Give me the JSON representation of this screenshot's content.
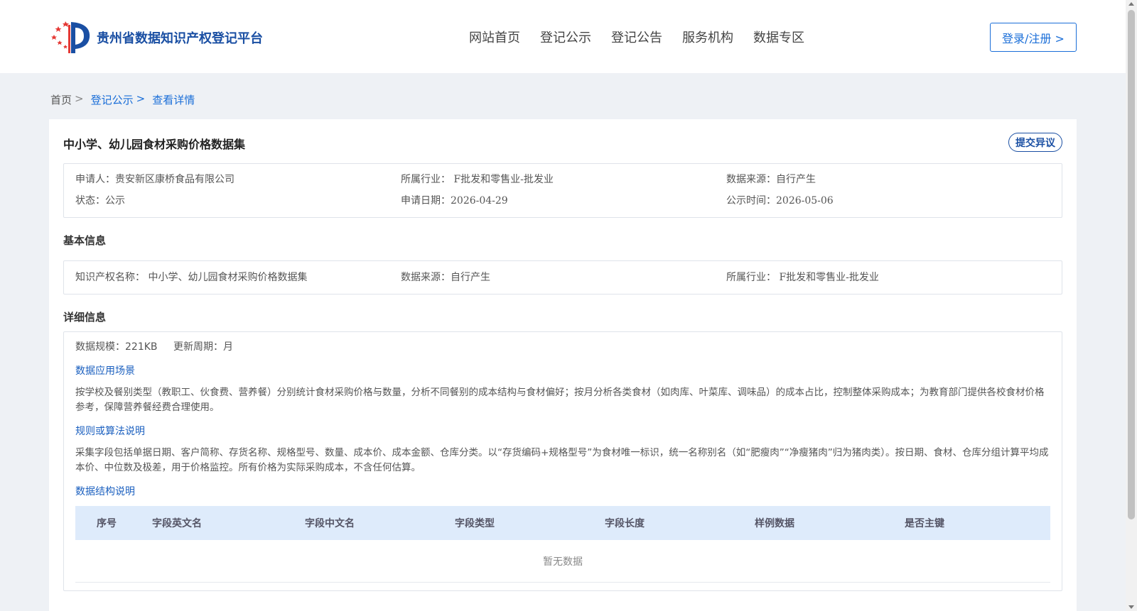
{
  "header": {
    "site_name": "贵州省数据知识产权登记平台",
    "nav": [
      "网站首页",
      "登记公示",
      "登记公告",
      "服务机构",
      "数据专区"
    ],
    "login_label": "登录/注册 >"
  },
  "breadcrumb": {
    "home": "首页",
    "sep": ">",
    "items": [
      "登记公示",
      "查看详情"
    ]
  },
  "detail": {
    "title": "中小学、幼儿园食材采购价格数据集",
    "objection_label": "提交异议",
    "summary": {
      "applicant": "申请人：贵安新区康桥食品有限公司",
      "industry": "所属行业： F批发和零售业-批发业",
      "source": "数据来源：自行产生",
      "status": "状态：公示",
      "apply_date": "申请日期：2026-04-29",
      "publish_date": "公示时间：2026-05-06"
    },
    "basic": {
      "section": "基本信息",
      "ip_name": "知识产权名称： 中小学、幼儿园食材采购价格数据集",
      "source": "数据来源：自行产生",
      "industry": "所属行业： F批发和零售业-批发业"
    },
    "more": {
      "section": "详细信息",
      "scale": "数据规模：221KB",
      "cycle": "更新周期：月",
      "scenario_title": "数据应用场景",
      "scenario_text": "按学校及餐别类型（教职工、伙食费、营养餐）分别统计食材采购价格与数量，分析不同餐别的成本结构与食材偏好；按月分析各类食材（如肉库、叶菜库、调味品）的成本占比，控制整体采购成本；为教育部门提供各校食材价格参考，保障营养餐经费合理使用。",
      "rules_title": "规则或算法说明",
      "rules_text": "采集字段包括单据日期、客户简称、存货名称、规格型号、数量、成本价、成本金额、仓库分类。以“存货编码+规格型号”为食材唯一标识，统一名称别名（如“肥瘦肉”“净瘦猪肉”归为猪肉类）。按日期、食材、仓库分组计算平均成本价、中位数及极差，用于价格监控。所有价格为实际采购成本，不含任何估算。",
      "structure_title": "数据结构说明",
      "table_headers": [
        "序号",
        "字段英文名",
        "字段中文名",
        "字段类型",
        "字段长度",
        "样例数据",
        "是否主键"
      ],
      "empty_text": "暂无数据"
    }
  },
  "colors": {
    "brand": "#1a4fa3",
    "link": "#1a6ed8",
    "table_header_bg": "#deebfb"
  }
}
